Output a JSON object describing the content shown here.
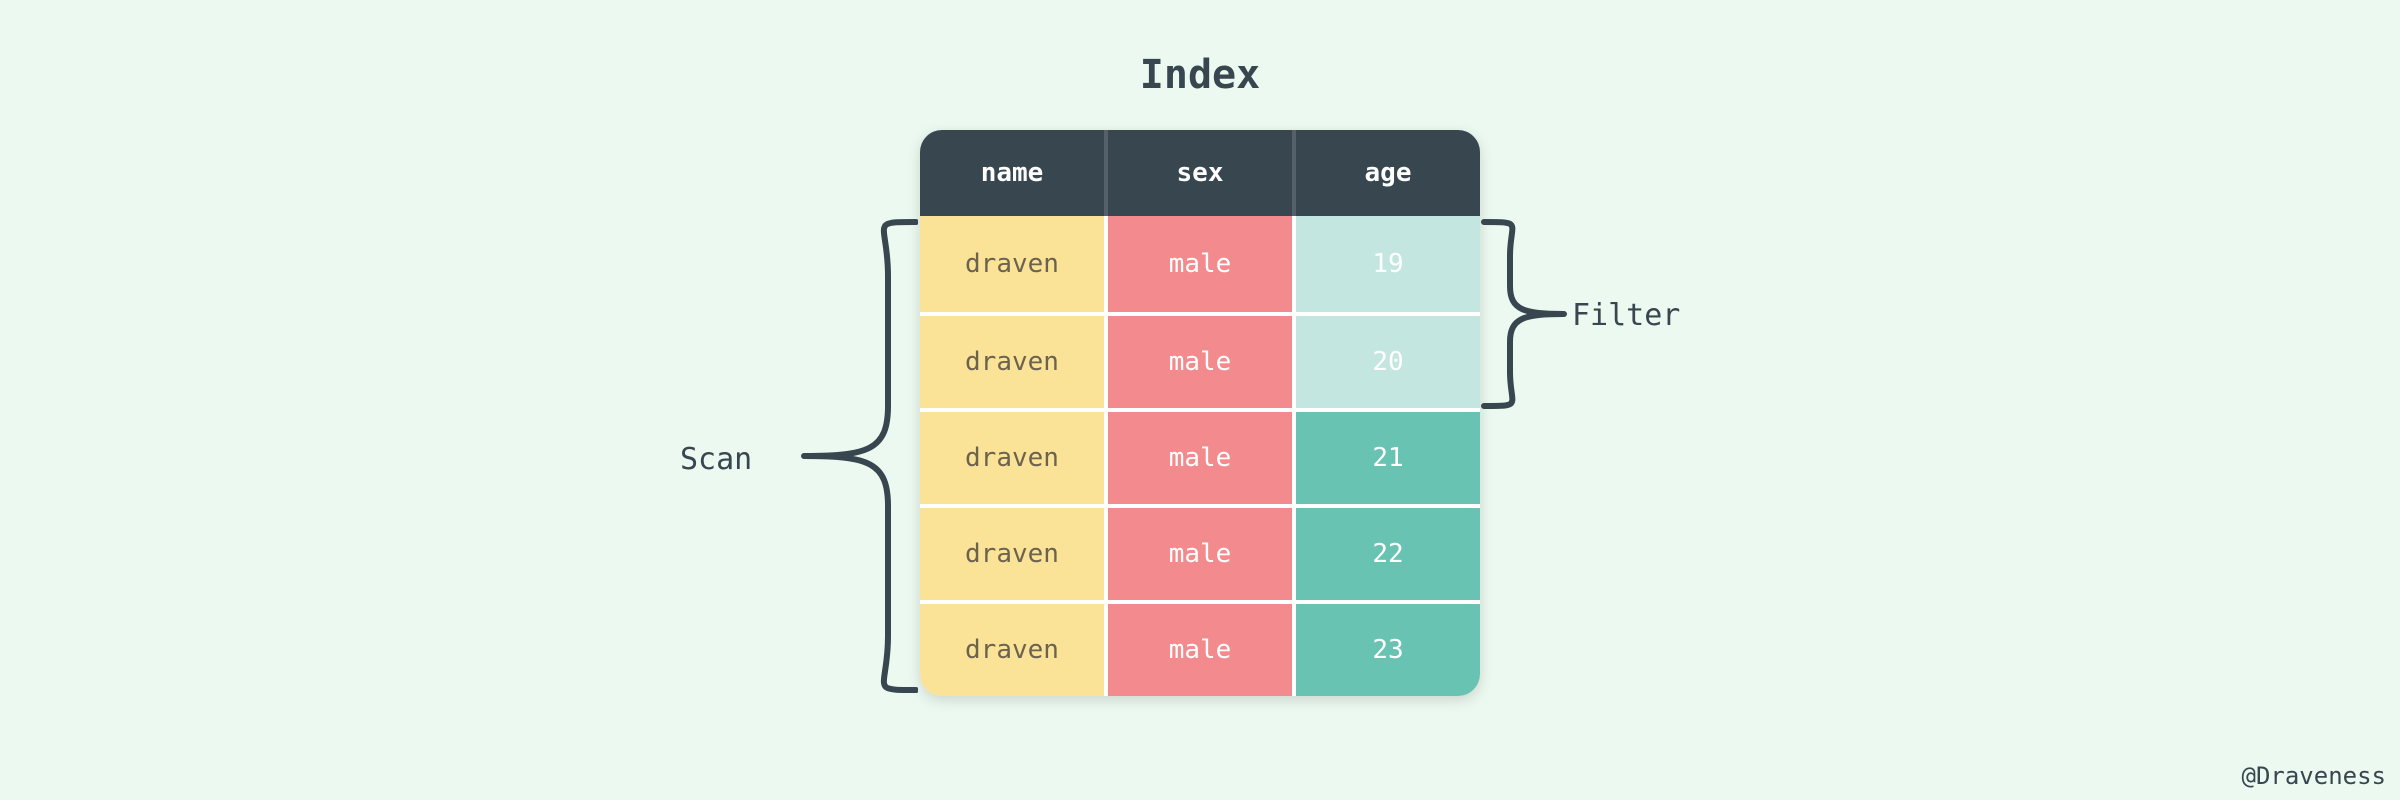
{
  "title": "Index",
  "columns": {
    "c0": "name",
    "c1": "sex",
    "c2": "age"
  },
  "rows": [
    {
      "name": "draven",
      "sex": "male",
      "age": "19",
      "filtered": true
    },
    {
      "name": "draven",
      "sex": "male",
      "age": "20",
      "filtered": true
    },
    {
      "name": "draven",
      "sex": "male",
      "age": "21",
      "filtered": false
    },
    {
      "name": "draven",
      "sex": "male",
      "age": "22",
      "filtered": false
    },
    {
      "name": "draven",
      "sex": "male",
      "age": "23",
      "filtered": false
    }
  ],
  "annotations": {
    "scan": "Scan",
    "filter": "Filter"
  },
  "credit": "@Draveness",
  "colors": {
    "bg": "#ecf9f0",
    "header": "#37464f",
    "name": "#fae396",
    "sex": "#f38a8d",
    "age": "#69c3b2",
    "age_filtered": "#c3e7e0"
  }
}
